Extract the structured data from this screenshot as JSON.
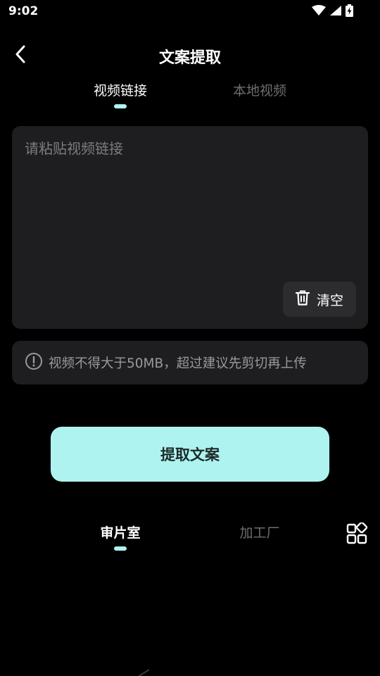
{
  "status_bar": {
    "time": "9:02",
    "icons": [
      "wifi-icon",
      "signal-icon",
      "battery-charging-icon"
    ]
  },
  "header": {
    "back_icon": "chevron-left-icon",
    "title": "文案提取"
  },
  "tabs": [
    {
      "label": "视频链接",
      "active": true
    },
    {
      "label": "本地视频",
      "active": false
    }
  ],
  "input": {
    "value": "",
    "placeholder": "请粘贴视频链接",
    "clear_label": "清空",
    "clear_icon": "trash-icon"
  },
  "notice": {
    "icon": "exclamation-circle-icon",
    "text": "视频不得大于50MB，超过建议先剪切再上传"
  },
  "extract_button": {
    "label": "提取文案"
  },
  "bottom_tabs": [
    {
      "label": "审片室",
      "active": true
    },
    {
      "label": "加工厂",
      "active": false
    }
  ],
  "bottom_grid_icon": "apps-grid-icon",
  "colors": {
    "accent": "#aef3ef",
    "card_bg": "#1e1e20",
    "background": "#000000",
    "muted_text": "#6f6f6f"
  }
}
